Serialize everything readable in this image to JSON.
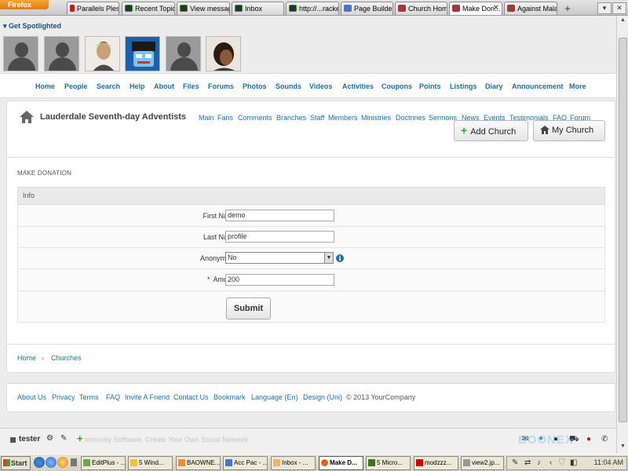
{
  "browser": {
    "menu_button": "Firefox",
    "tabs": [
      {
        "label": "Parallels Ples...",
        "icon": "parallels-icon",
        "active": false
      },
      {
        "label": "Recent Topic...",
        "icon": "green-site-icon",
        "active": false
      },
      {
        "label": "View message",
        "icon": "green-site-icon",
        "active": false
      },
      {
        "label": "Inbox",
        "icon": "green-site-icon",
        "active": false
      },
      {
        "label": "http://...racker",
        "icon": "green-site-icon",
        "active": false
      },
      {
        "label": "Page Builder",
        "icon": "page-builder-icon",
        "active": false
      },
      {
        "label": "Church Home",
        "icon": "church-icon",
        "active": false
      },
      {
        "label": "Make Don...",
        "icon": "church-icon",
        "active": true
      },
      {
        "label": "Against Mala...",
        "icon": "church-icon",
        "active": false
      }
    ],
    "new_tab": "+",
    "list_tabs": "▾",
    "window_close": "✕"
  },
  "spotlight": {
    "title": "Get Spotlighted",
    "avatars": [
      "default-avatar",
      "default-avatar",
      "photo-avatar",
      "cartoon-avatar",
      "default-avatar",
      "photo-avatar"
    ]
  },
  "nav": [
    "Home",
    "People",
    "Search",
    "Help",
    "About",
    "Files",
    "Forums",
    "Photos",
    "Sounds",
    "Videos",
    "Activities",
    "Coupons",
    "Points",
    "Listings",
    "Diary",
    "Announcement",
    "More"
  ],
  "church": {
    "name": "Lauderdale Seventh-day Adventists",
    "submenu": [
      "Main",
      "Fans",
      "Comments",
      "Branches",
      "Staff",
      "Members",
      "Ministries",
      "Doctrines",
      "Sermons",
      "News",
      "Events",
      "Testimonials",
      "FAQ",
      "Forum"
    ],
    "add_button": "Add Church",
    "my_button": "My Church"
  },
  "form": {
    "title": "MAKE DONATION",
    "section": "Info",
    "first_name_label": "First Name:",
    "first_name_value": "demo",
    "last_name_label": "Last Name:",
    "last_name_value": "profile",
    "anonymous_label": "Anonymous:",
    "anonymous_value": "No",
    "amount_required": "*",
    "amount_label": "Amount:",
    "amount_value": "200",
    "submit": "Submit"
  },
  "breadcrumb": {
    "home": "Home",
    "sep": "›",
    "current": "Churches"
  },
  "footer": {
    "links": [
      "About Us",
      "Privacy",
      "Terms",
      "FAQ",
      "Invite A Friend",
      "Contact Us",
      "Bookmark",
      "Language (En)",
      "Design (Uni)"
    ],
    "copyright": "© 2013 YourCompany"
  },
  "sitebar": {
    "user": "tester",
    "tagline": "mmunity Software. Create Your Own Social Network",
    "watermark": "BOONEX"
  },
  "taskbar": {
    "start": "Start",
    "items": [
      {
        "label": "EditPlus - ...",
        "active": false
      },
      {
        "label": "5 Wind...",
        "active": false
      },
      {
        "label": "BAOWNE...",
        "active": false
      },
      {
        "label": "Acc Pac - ...",
        "active": false
      },
      {
        "label": "Inbox - ...",
        "active": false
      },
      {
        "label": "Make D...",
        "active": true
      },
      {
        "label": "5 Micro...",
        "active": false
      },
      {
        "label": "modzzz...",
        "active": false
      },
      {
        "label": "view2.jp...",
        "active": false
      }
    ],
    "clock": "11:04 AM"
  }
}
